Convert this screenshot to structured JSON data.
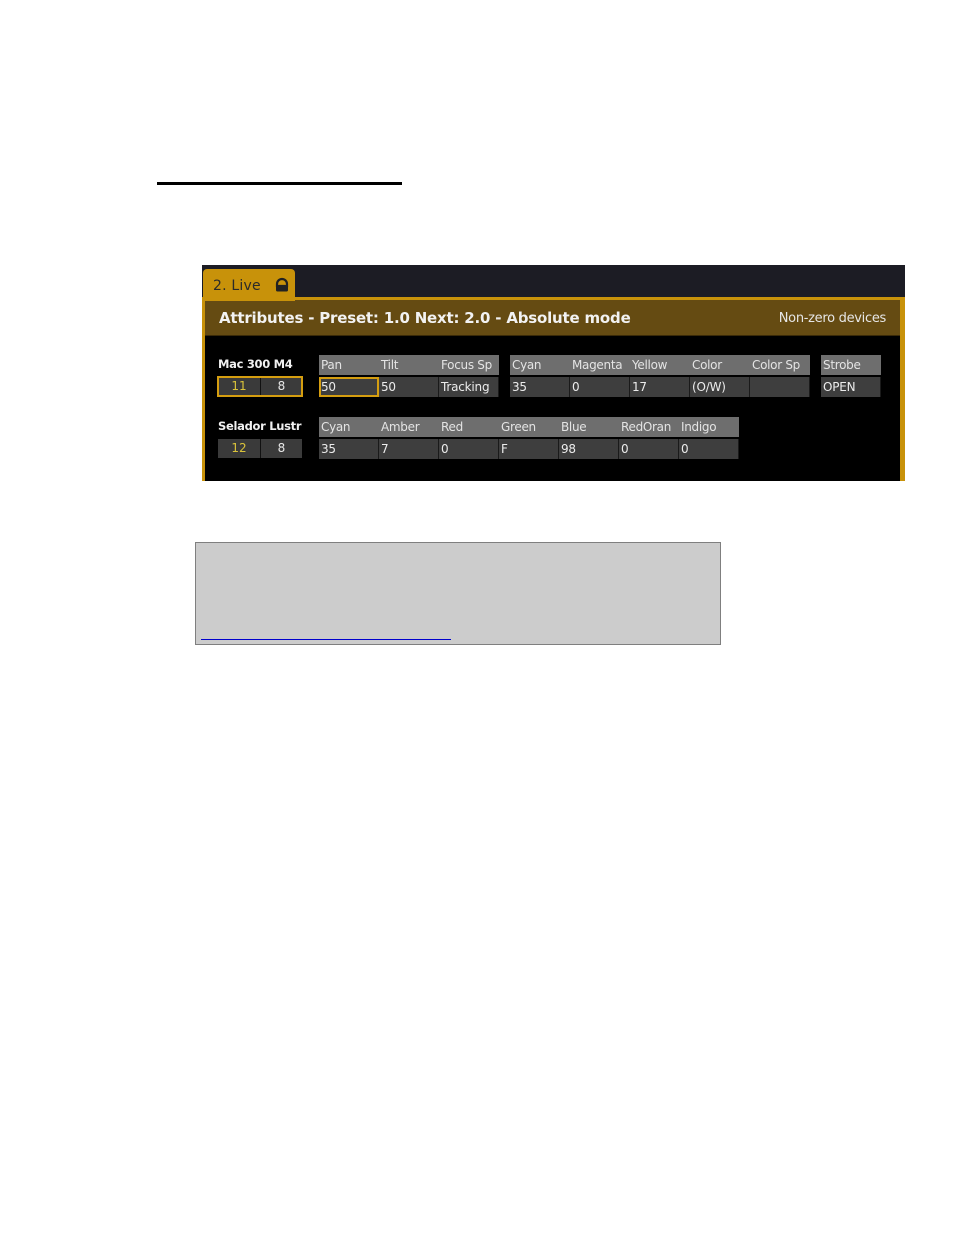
{
  "panel": {
    "tab_label": "2. Live",
    "tab_icon": "lock-icon",
    "title": "Attributes - Preset: 1.0 Next: 2.0 - Absolute mode",
    "filter_label": "Non-zero devices",
    "accent_color": "#c8920a",
    "title_bar_color": "#654b12"
  },
  "devices": [
    {
      "name": "Mac 300 M4",
      "channel": "11",
      "count": "8",
      "selected": true,
      "groups": [
        {
          "columns": [
            {
              "header": "Pan",
              "value": "50",
              "active": true
            },
            {
              "header": "Tilt",
              "value": "50"
            },
            {
              "header": "Focus Sp",
              "value": "Tracking"
            }
          ]
        },
        {
          "columns": [
            {
              "header": "Cyan",
              "value": "35"
            },
            {
              "header": "Magenta",
              "value": "0"
            },
            {
              "header": "Yellow",
              "value": "17"
            },
            {
              "header": "Color",
              "value": "(O/W)"
            },
            {
              "header": "Color Sp",
              "value": ""
            }
          ]
        },
        {
          "columns": [
            {
              "header": "Strobe",
              "value": "OPEN"
            }
          ]
        }
      ]
    },
    {
      "name": "Selador Lustr",
      "channel": "12",
      "count": "8",
      "selected": false,
      "groups": [
        {
          "columns": [
            {
              "header": "Cyan",
              "value": "35"
            },
            {
              "header": "Amber",
              "value": "7"
            },
            {
              "header": "Red",
              "value": "0"
            },
            {
              "header": "Green",
              "value": "F"
            },
            {
              "header": "Blue",
              "value": "98"
            },
            {
              "header": "RedOran",
              "value": "0"
            },
            {
              "header": "Indigo",
              "value": "0"
            }
          ]
        }
      ]
    }
  ]
}
